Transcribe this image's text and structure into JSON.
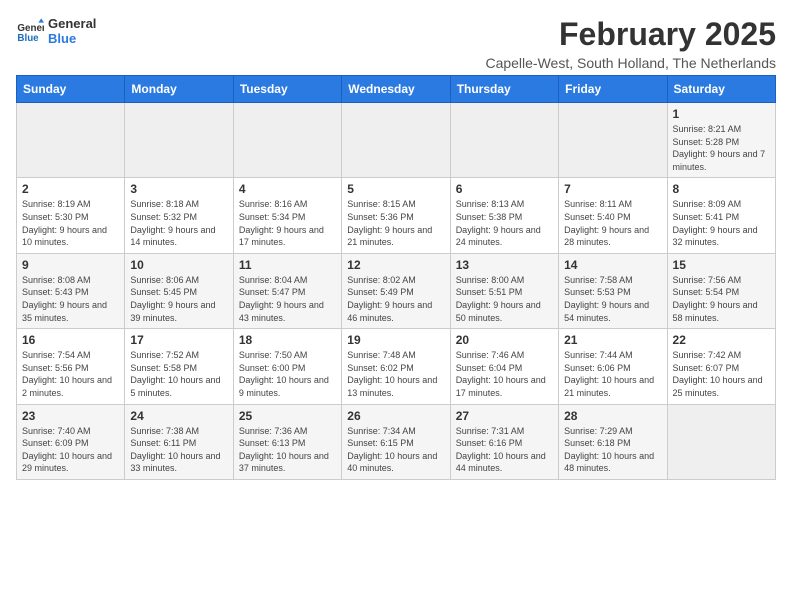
{
  "header": {
    "logo_line1": "General",
    "logo_line2": "Blue",
    "month_title": "February 2025",
    "location": "Capelle-West, South Holland, The Netherlands"
  },
  "weekdays": [
    "Sunday",
    "Monday",
    "Tuesday",
    "Wednesday",
    "Thursday",
    "Friday",
    "Saturday"
  ],
  "weeks": [
    [
      {
        "day": "",
        "info": ""
      },
      {
        "day": "",
        "info": ""
      },
      {
        "day": "",
        "info": ""
      },
      {
        "day": "",
        "info": ""
      },
      {
        "day": "",
        "info": ""
      },
      {
        "day": "",
        "info": ""
      },
      {
        "day": "1",
        "info": "Sunrise: 8:21 AM\nSunset: 5:28 PM\nDaylight: 9 hours and 7 minutes."
      }
    ],
    [
      {
        "day": "2",
        "info": "Sunrise: 8:19 AM\nSunset: 5:30 PM\nDaylight: 9 hours and 10 minutes."
      },
      {
        "day": "3",
        "info": "Sunrise: 8:18 AM\nSunset: 5:32 PM\nDaylight: 9 hours and 14 minutes."
      },
      {
        "day": "4",
        "info": "Sunrise: 8:16 AM\nSunset: 5:34 PM\nDaylight: 9 hours and 17 minutes."
      },
      {
        "day": "5",
        "info": "Sunrise: 8:15 AM\nSunset: 5:36 PM\nDaylight: 9 hours and 21 minutes."
      },
      {
        "day": "6",
        "info": "Sunrise: 8:13 AM\nSunset: 5:38 PM\nDaylight: 9 hours and 24 minutes."
      },
      {
        "day": "7",
        "info": "Sunrise: 8:11 AM\nSunset: 5:40 PM\nDaylight: 9 hours and 28 minutes."
      },
      {
        "day": "8",
        "info": "Sunrise: 8:09 AM\nSunset: 5:41 PM\nDaylight: 9 hours and 32 minutes."
      }
    ],
    [
      {
        "day": "9",
        "info": "Sunrise: 8:08 AM\nSunset: 5:43 PM\nDaylight: 9 hours and 35 minutes."
      },
      {
        "day": "10",
        "info": "Sunrise: 8:06 AM\nSunset: 5:45 PM\nDaylight: 9 hours and 39 minutes."
      },
      {
        "day": "11",
        "info": "Sunrise: 8:04 AM\nSunset: 5:47 PM\nDaylight: 9 hours and 43 minutes."
      },
      {
        "day": "12",
        "info": "Sunrise: 8:02 AM\nSunset: 5:49 PM\nDaylight: 9 hours and 46 minutes."
      },
      {
        "day": "13",
        "info": "Sunrise: 8:00 AM\nSunset: 5:51 PM\nDaylight: 9 hours and 50 minutes."
      },
      {
        "day": "14",
        "info": "Sunrise: 7:58 AM\nSunset: 5:53 PM\nDaylight: 9 hours and 54 minutes."
      },
      {
        "day": "15",
        "info": "Sunrise: 7:56 AM\nSunset: 5:54 PM\nDaylight: 9 hours and 58 minutes."
      }
    ],
    [
      {
        "day": "16",
        "info": "Sunrise: 7:54 AM\nSunset: 5:56 PM\nDaylight: 10 hours and 2 minutes."
      },
      {
        "day": "17",
        "info": "Sunrise: 7:52 AM\nSunset: 5:58 PM\nDaylight: 10 hours and 5 minutes."
      },
      {
        "day": "18",
        "info": "Sunrise: 7:50 AM\nSunset: 6:00 PM\nDaylight: 10 hours and 9 minutes."
      },
      {
        "day": "19",
        "info": "Sunrise: 7:48 AM\nSunset: 6:02 PM\nDaylight: 10 hours and 13 minutes."
      },
      {
        "day": "20",
        "info": "Sunrise: 7:46 AM\nSunset: 6:04 PM\nDaylight: 10 hours and 17 minutes."
      },
      {
        "day": "21",
        "info": "Sunrise: 7:44 AM\nSunset: 6:06 PM\nDaylight: 10 hours and 21 minutes."
      },
      {
        "day": "22",
        "info": "Sunrise: 7:42 AM\nSunset: 6:07 PM\nDaylight: 10 hours and 25 minutes."
      }
    ],
    [
      {
        "day": "23",
        "info": "Sunrise: 7:40 AM\nSunset: 6:09 PM\nDaylight: 10 hours and 29 minutes."
      },
      {
        "day": "24",
        "info": "Sunrise: 7:38 AM\nSunset: 6:11 PM\nDaylight: 10 hours and 33 minutes."
      },
      {
        "day": "25",
        "info": "Sunrise: 7:36 AM\nSunset: 6:13 PM\nDaylight: 10 hours and 37 minutes."
      },
      {
        "day": "26",
        "info": "Sunrise: 7:34 AM\nSunset: 6:15 PM\nDaylight: 10 hours and 40 minutes."
      },
      {
        "day": "27",
        "info": "Sunrise: 7:31 AM\nSunset: 6:16 PM\nDaylight: 10 hours and 44 minutes."
      },
      {
        "day": "28",
        "info": "Sunrise: 7:29 AM\nSunset: 6:18 PM\nDaylight: 10 hours and 48 minutes."
      },
      {
        "day": "",
        "info": ""
      }
    ]
  ]
}
